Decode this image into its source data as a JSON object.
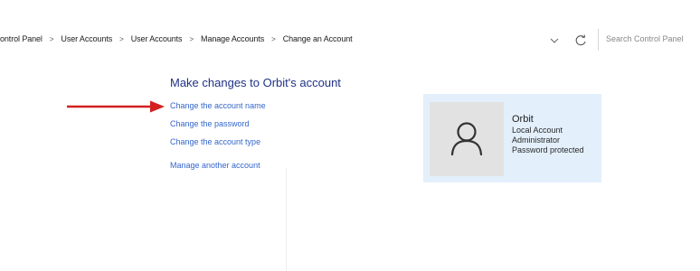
{
  "address_bar": {
    "breadcrumbs": [
      "ontrol Panel",
      "User Accounts",
      "User Accounts",
      "Manage Accounts",
      "Change an Account"
    ],
    "separator": ">",
    "search_placeholder": "Search Control Panel"
  },
  "task": {
    "title": "Make changes to Orbit's account",
    "links": [
      "Change the account name",
      "Change the password",
      "Change the account type",
      "Manage another account"
    ]
  },
  "account": {
    "name": "Orbit",
    "type": "Local Account",
    "role": "Administrator",
    "status": "Password protected"
  },
  "icons": {
    "dropdown": "chevron-down-icon",
    "refresh": "refresh-icon",
    "avatar": "user-icon",
    "annotation": "red-arrow-icon"
  },
  "colors": {
    "title": "#1e3287",
    "link": "#3366cc",
    "card_background": "#e3effb",
    "avatar_background": "#e2e2e2",
    "arrow": "#d32020"
  }
}
